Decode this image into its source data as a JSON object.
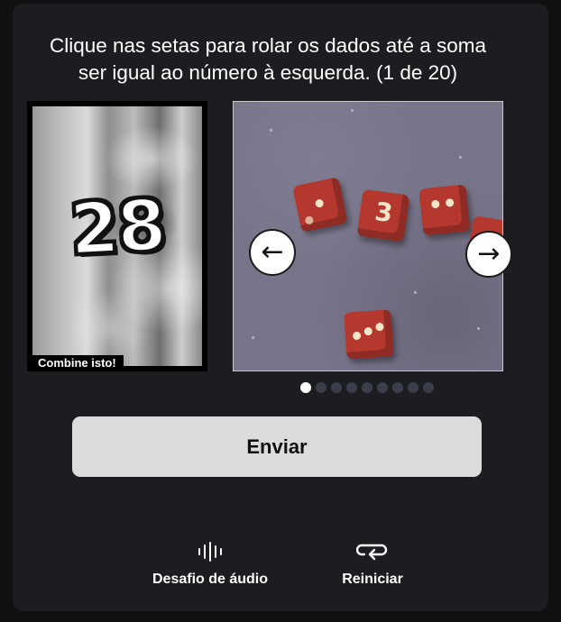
{
  "instructions": {
    "line1": "Clique nas setas para rolar os dados até a soma",
    "line2": "ser igual ao número à esquerda. (1 de 20)"
  },
  "target": {
    "number": "28",
    "caption": "Combine isto!"
  },
  "dice": [
    {
      "type": "pips",
      "pips": 2
    },
    {
      "type": "digit",
      "value": "3"
    },
    {
      "type": "pips",
      "pips": 2
    },
    {
      "type": "pips",
      "pips": 3
    }
  ],
  "arrows": {
    "left_icon": "arrow-left-icon",
    "right_icon": "arrow-right-icon",
    "left_glyph": "←",
    "right_glyph": "→"
  },
  "pagination": {
    "total": 9,
    "active_index": 0
  },
  "submit": {
    "label": "Enviar"
  },
  "footer": {
    "audio": {
      "label": "Desafio de áudio",
      "icon": "audio-wave-icon"
    },
    "restart": {
      "label": "Reiniciar",
      "icon": "restart-icon"
    }
  },
  "colors": {
    "panel": "#1c1d20",
    "submit_bg": "#dcdcdc",
    "die": "#b5382f",
    "dot_active": "#ffffff",
    "dot_inactive": "#3b3d4a"
  }
}
